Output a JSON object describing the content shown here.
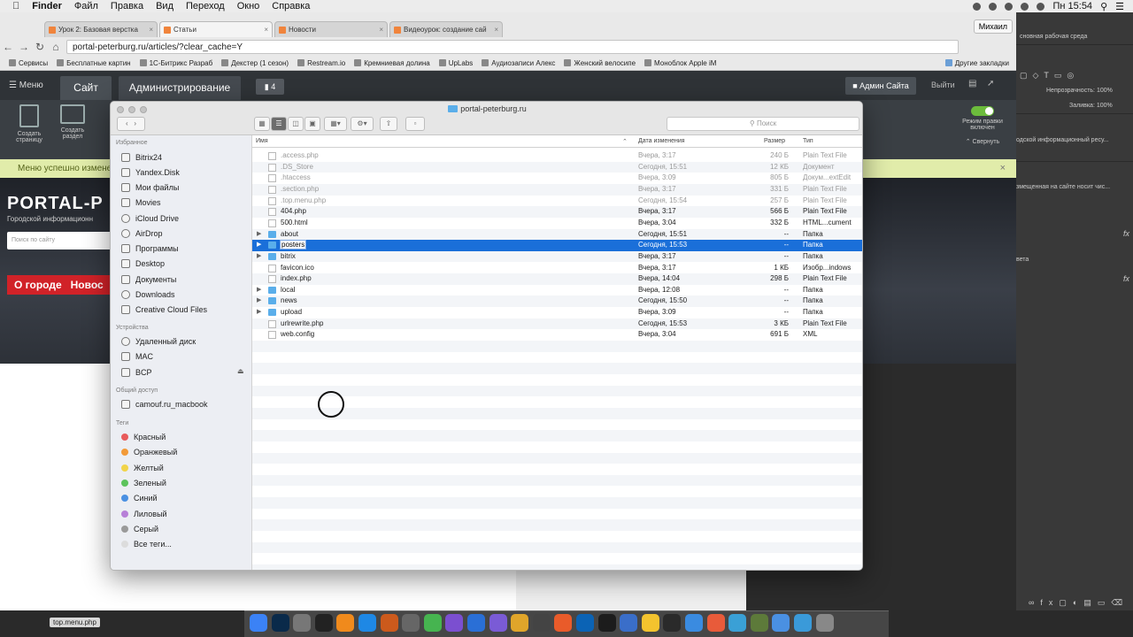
{
  "menubar": {
    "apple": "",
    "app": "Finder",
    "items": [
      "Файл",
      "Правка",
      "Вид",
      "Переход",
      "Окно",
      "Справка"
    ],
    "clock": "Пн 15:54"
  },
  "browser": {
    "tabs": [
      {
        "label": "Урок 2: Базовая верстка"
      },
      {
        "label": "Статьи"
      },
      {
        "label": "Новости"
      },
      {
        "label": "Видеоурок: создание сай"
      }
    ],
    "user": "Михаил",
    "url": "portal-peterburg.ru/articles/?clear_cache=Y",
    "bookmarks": [
      "Сервисы",
      "Бесплатные картин",
      "1С-Битрикс Разраб",
      "Декстер (1 сезон) ",
      "Restream.io",
      "Кремниевая долина",
      "UpLabs",
      "Аудиозаписи Алекс",
      "Женский велосипе",
      "Моноблок Apple iM"
    ],
    "other_bookmarks": "Другие закладки"
  },
  "bitrix": {
    "menu": "Меню",
    "site_tab": "Сайт",
    "admin_tab": "Администрирование",
    "notif_count": "4",
    "user": "Админ Сайта",
    "logout": "Выйти",
    "tool1": "Создать страницу",
    "tool2": "Создать раздел",
    "edit_mode": "Режим правки включен",
    "collapse": "Свернуть",
    "notice": "Меню успешно измене"
  },
  "site": {
    "logo": "PORTAL-P",
    "subtitle": "Городской информационн",
    "search_placeholder": "Поиск по сайту",
    "nav": [
      "О городе",
      "Новос"
    ]
  },
  "photoshop": {
    "workspace": "сновная рабочая среда",
    "opacity_label": "Непрозрачность:",
    "opacity": "100%",
    "fill_label": "Заливка:",
    "fill": "100%",
    "layer1": "одской информационный ресу...",
    "layer2": "змещенная на сайте носит чис...",
    "layer3": "вета"
  },
  "finder": {
    "title": "portal-peterburg.ru",
    "search_placeholder": "Поиск",
    "sidebar": {
      "favorites_head": "Избранное",
      "favorites": [
        "Bitrix24",
        "Yandex.Disk",
        "Мои файлы",
        "Movies",
        "iCloud Drive",
        "AirDrop",
        "Программы",
        "Desktop",
        "Документы",
        "Downloads",
        "Creative Cloud Files"
      ],
      "devices_head": "Устройства",
      "devices": [
        "Удаленный диск",
        "MAC",
        "BCP"
      ],
      "shared_head": "Общий доступ",
      "shared": [
        "camouf.ru_macbook"
      ],
      "tags_head": "Теги",
      "tags": [
        {
          "label": "Красный",
          "color": "#e85b5b"
        },
        {
          "label": "Оранжевый",
          "color": "#f29a38"
        },
        {
          "label": "Желтый",
          "color": "#f1d44a"
        },
        {
          "label": "Зеленый",
          "color": "#5cc35c"
        },
        {
          "label": "Синий",
          "color": "#4a90e2"
        },
        {
          "label": "Лиловый",
          "color": "#b77fd8"
        },
        {
          "label": "Серый",
          "color": "#9a9a9a"
        },
        {
          "label": "Все теги...",
          "color": "#dcdcdc"
        }
      ]
    },
    "columns": {
      "name": "Имя",
      "date": "Дата изменения",
      "size": "Размер",
      "type": "Тип"
    },
    "files": [
      {
        "name": ".access.php",
        "date": "Вчера, 3:17",
        "size": "240 Б",
        "type": "Plain Text File",
        "kind": "file",
        "dim": true
      },
      {
        "name": ".DS_Store",
        "date": "Сегодня, 15:51",
        "size": "12 КБ",
        "type": "Документ",
        "kind": "file",
        "dim": true
      },
      {
        "name": ".htaccess",
        "date": "Вчера, 3:09",
        "size": "805 Б",
        "type": "Докум...extEdit",
        "kind": "file",
        "dim": true
      },
      {
        "name": ".section.php",
        "date": "Вчера, 3:17",
        "size": "331 Б",
        "type": "Plain Text File",
        "kind": "file",
        "dim": true
      },
      {
        "name": ".top.menu.php",
        "date": "Сегодня, 15:54",
        "size": "257 Б",
        "type": "Plain Text File",
        "kind": "file",
        "dim": true
      },
      {
        "name": "404.php",
        "date": "Вчера, 3:17",
        "size": "566 Б",
        "type": "Plain Text File",
        "kind": "file",
        "dim": false
      },
      {
        "name": "500.html",
        "date": "Вчера, 3:04",
        "size": "332 Б",
        "type": "HTML...cument",
        "kind": "file",
        "dim": false
      },
      {
        "name": "about",
        "date": "Сегодня, 15:51",
        "size": "--",
        "type": "Папка",
        "kind": "folder",
        "dim": false
      },
      {
        "name": "posters",
        "date": "Сегодня, 15:53",
        "size": "--",
        "type": "Папка",
        "kind": "folder",
        "dim": false,
        "selected": true
      },
      {
        "name": "bitrix",
        "date": "Вчера, 3:17",
        "size": "--",
        "type": "Папка",
        "kind": "folder",
        "dim": false
      },
      {
        "name": "favicon.ico",
        "date": "Вчера, 3:17",
        "size": "1 КБ",
        "type": "Изобр...indows",
        "kind": "file",
        "dim": false
      },
      {
        "name": "index.php",
        "date": "Вчера, 14:04",
        "size": "298 Б",
        "type": "Plain Text File",
        "kind": "file",
        "dim": false
      },
      {
        "name": "local",
        "date": "Вчера, 12:08",
        "size": "--",
        "type": "Папка",
        "kind": "folder",
        "dim": false
      },
      {
        "name": "news",
        "date": "Сегодня, 15:50",
        "size": "--",
        "type": "Папка",
        "kind": "folder",
        "dim": false
      },
      {
        "name": "upload",
        "date": "Вчера, 3:09",
        "size": "--",
        "type": "Папка",
        "kind": "folder",
        "dim": false
      },
      {
        "name": "urlrewrite.php",
        "date": "Сегодня, 15:53",
        "size": "3 КБ",
        "type": "Plain Text File",
        "kind": "file",
        "dim": false
      },
      {
        "name": "web.config",
        "date": "Вчера, 3:04",
        "size": "691 Б",
        "type": "XML",
        "kind": "file",
        "dim": false
      }
    ]
  },
  "dock": {
    "tooltip": "top.menu.php"
  },
  "colors": {
    "selection": "#1a6fd9",
    "folder": "#5aaeea",
    "notice_bg": "#e1ecaa"
  }
}
